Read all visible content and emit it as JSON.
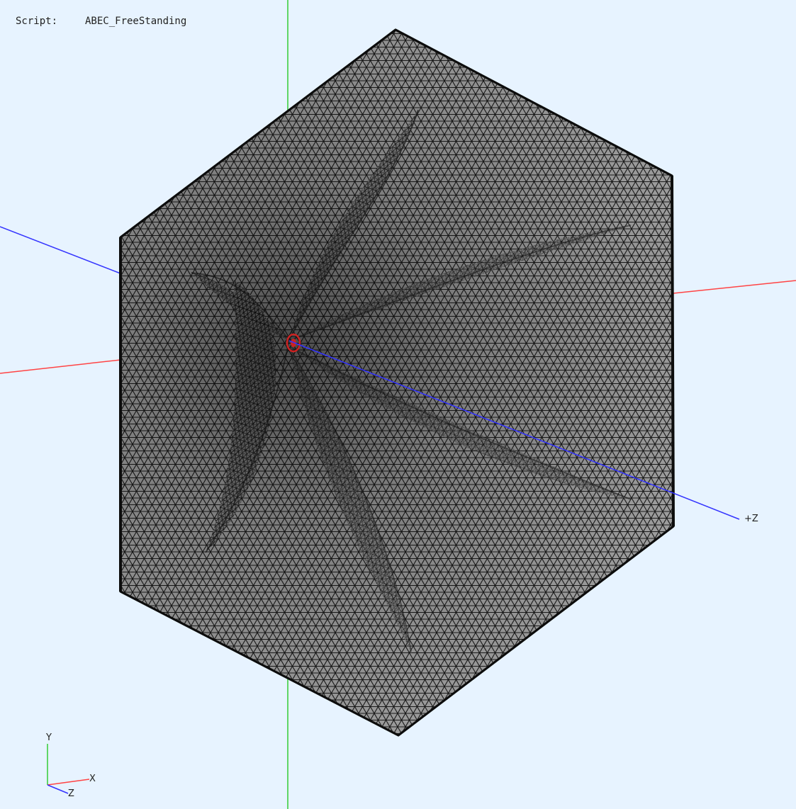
{
  "header": {
    "script_label": "Script:",
    "script_name": "ABEC_FreeStanding"
  },
  "axes": {
    "z_label": "+Z",
    "colors": {
      "x_axis": "#ff4444",
      "y_axis": "#33cc33",
      "z_axis": "#3333ff"
    }
  },
  "triad": {
    "y_label": "Y",
    "x_label": "X",
    "z_label": "Z"
  },
  "mesh": {
    "face_color": "#a8a8a8",
    "line_color": "#1a1a1a",
    "source_color": "#cc2222"
  }
}
